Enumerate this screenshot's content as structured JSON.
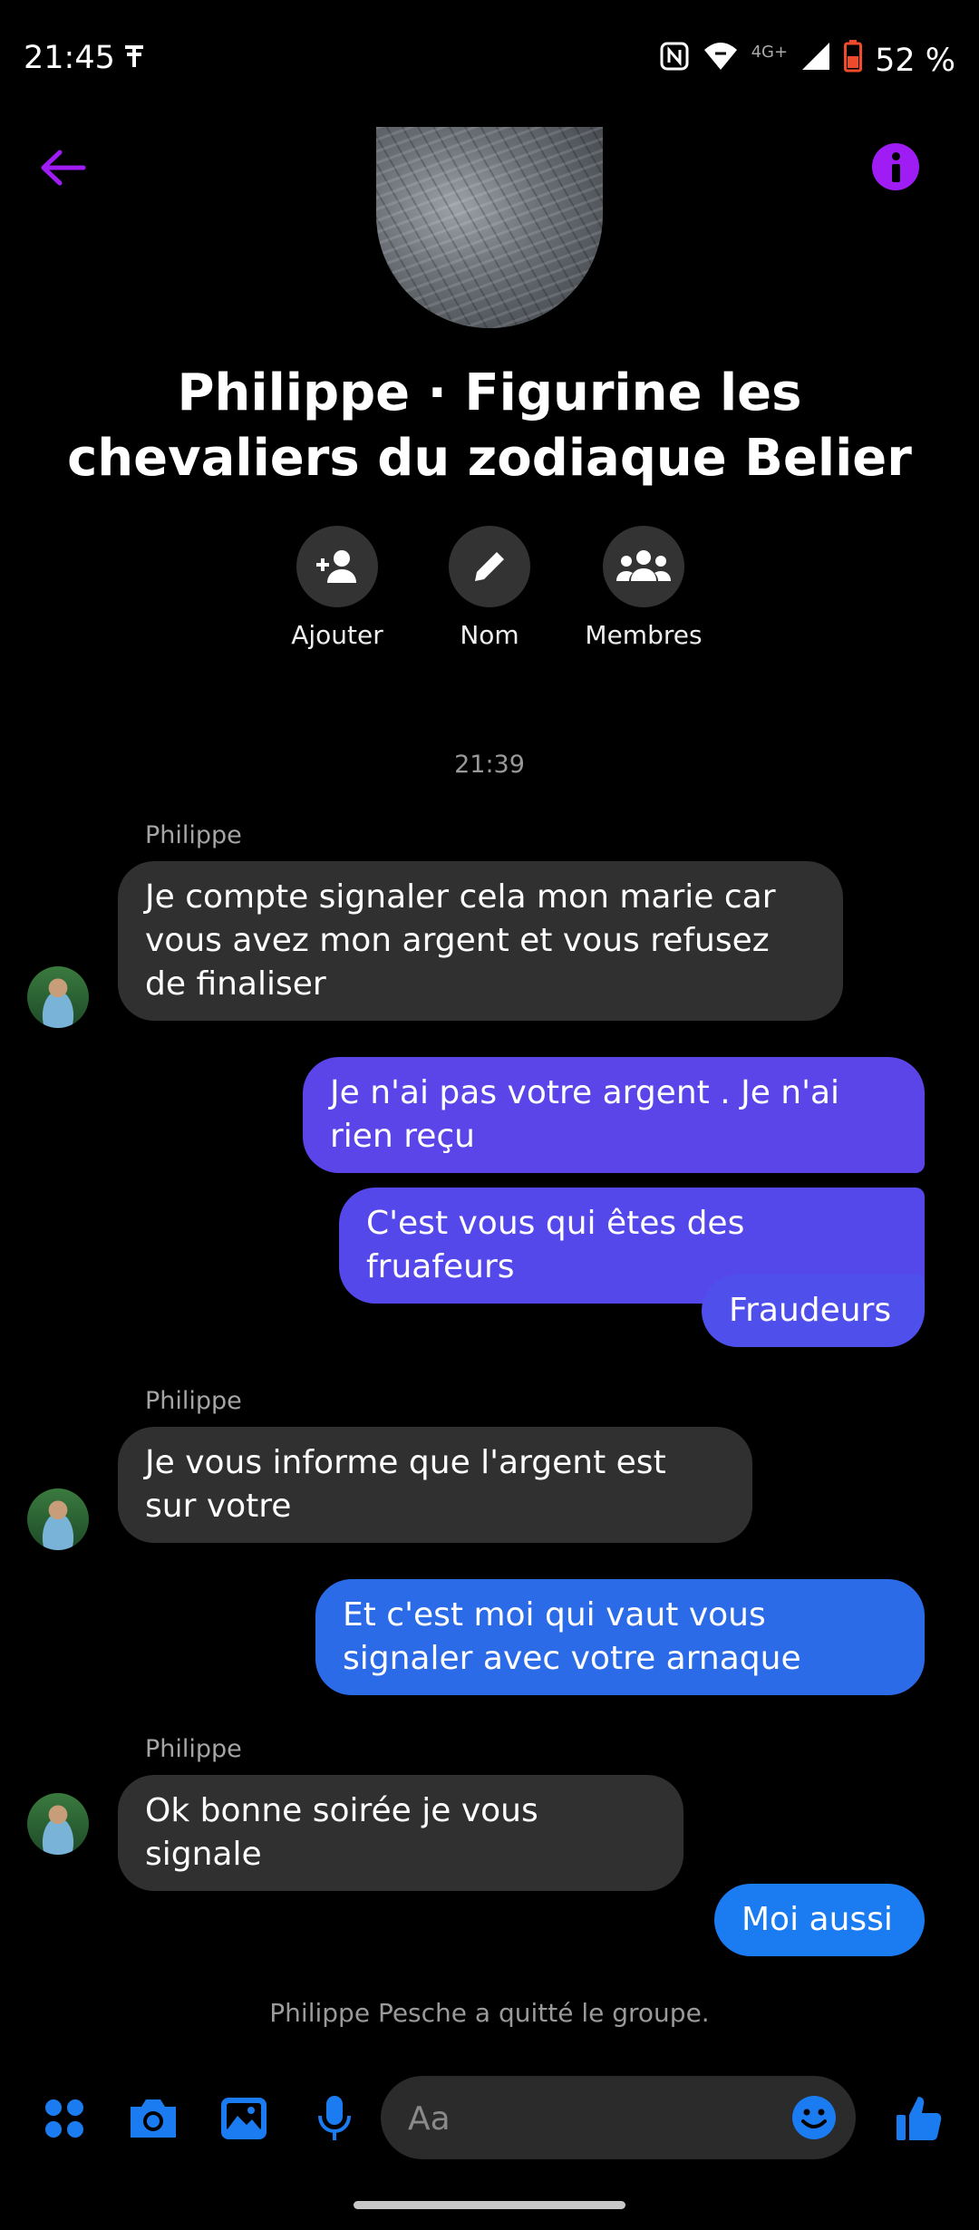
{
  "status_bar": {
    "time": "21:45",
    "network": "4G+",
    "battery": "52 %"
  },
  "header": {
    "back_icon": "arrow-left-icon",
    "info_icon": "info-icon",
    "accent": "#9f1cf5"
  },
  "conversation": {
    "title": "Philippe · Figurine les chevaliers du zodiaque Belier",
    "actions": [
      {
        "label": "Ajouter",
        "icon": "add-person-icon"
      },
      {
        "label": "Nom",
        "icon": "pencil-icon"
      },
      {
        "label": "Membres",
        "icon": "group-icon"
      }
    ]
  },
  "thread": {
    "timestamp": "21:39",
    "messages": [
      {
        "sender": "Philippe",
        "text": "Je compte signaler cela mon marie car vous avez mon argent et vous refusez de finaliser",
        "direction": "in"
      },
      {
        "text": "Je n'ai pas votre argent . Je n'ai rien reçu",
        "direction": "out",
        "color": "#5b45e8"
      },
      {
        "text": "C'est vous qui êtes des fruafeurs",
        "direction": "out",
        "color": "#5548ea"
      },
      {
        "text": "Fraudeurs",
        "direction": "out",
        "color": "#4f4fec"
      },
      {
        "sender": "Philippe",
        "text": "Je vous informe que l'argent est sur votre",
        "direction": "in"
      },
      {
        "text": "Et c'est moi qui vaut vous signaler avec votre arnaque",
        "direction": "out",
        "color": "#2c6be8"
      },
      {
        "sender": "Philippe",
        "text": "Ok bonne soirée je vous signale",
        "direction": "in"
      },
      {
        "text": "Moi aussi",
        "direction": "out",
        "color": "#1a7cf0"
      }
    ],
    "system_message": "Philippe Pesche a quitté le groupe."
  },
  "composer": {
    "placeholder": "Aa",
    "tool_color": "#1a7cf0",
    "tools": [
      "apps-icon",
      "camera-icon",
      "gallery-icon",
      "microphone-icon"
    ],
    "emoji_icon": "smiley-icon",
    "like_icon": "thumbs-up-icon"
  }
}
